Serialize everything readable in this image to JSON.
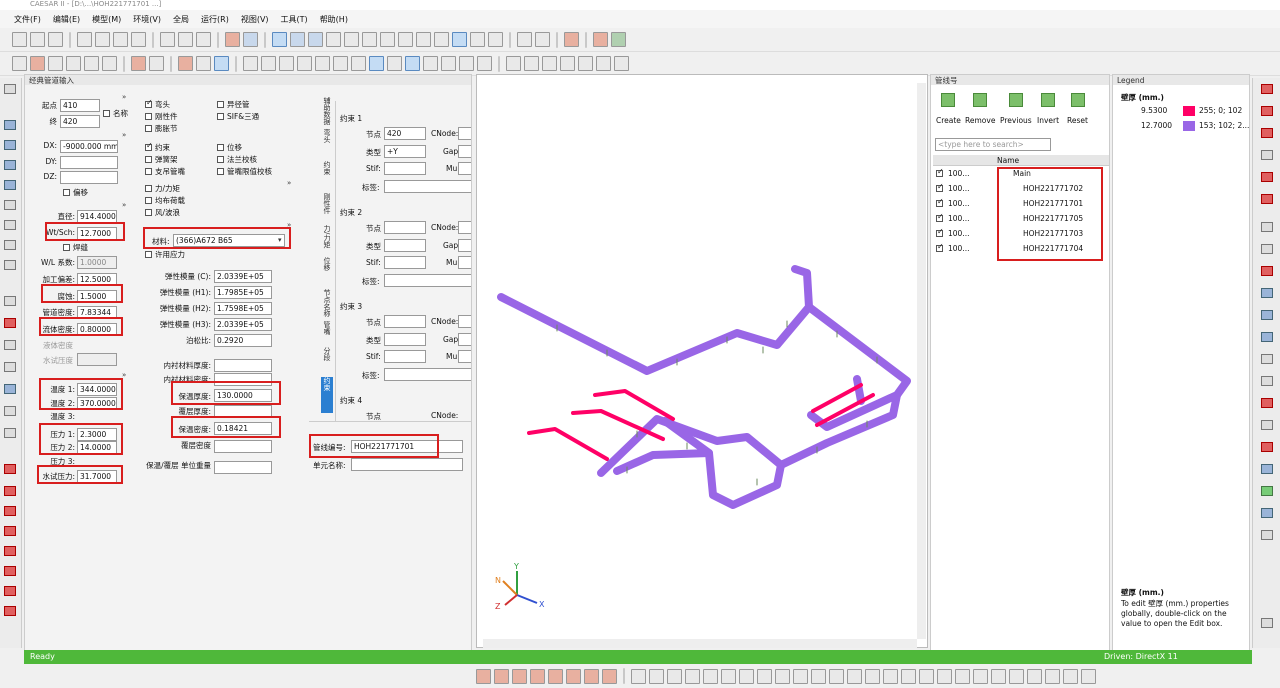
{
  "window": {
    "title": "CAESAR II - [D:\\...\\HOH221771701 ...]"
  },
  "menu": [
    "文件(F)",
    "编辑(E)",
    "模型(M)",
    "环境(V)",
    "全局",
    "运行(R)",
    "视图(V)",
    "工具(T)",
    "帮助(H)"
  ],
  "left_panel": {
    "title": "经典管道输入",
    "from_label": "起点",
    "from_value": "410",
    "to_label": "终",
    "to_value": "420",
    "name_label": "名称",
    "dx_label": "DX:",
    "dx_value": "-9000.000 mm",
    "dy_label": "DY:",
    "dz_label": "DZ:",
    "offset_label": "偏移",
    "diameter_label": "直径:",
    "diameter_value": "914.4000",
    "wt_label": "Wt/Sch:",
    "wt_value": "12.7000",
    "seam_label": "焊缝",
    "wl_factor_label": "W/L 系数:",
    "wl_factor_value": "1.0000",
    "mill_tol_label": "加工偏差:",
    "mill_tol_value": "12.5000",
    "corrosion_label": "腐蚀:",
    "corrosion_value": "1.5000",
    "pipe_density_label": "管道密度:",
    "pipe_density_value": "7.83344",
    "fluid_density_label": "流体密度:",
    "fluid_density_value": "0.80000",
    "liquid_label": "液体密度",
    "hydro_density_label": "水试压度",
    "temp1_label": "温度 1:",
    "temp1_value": "344.0000",
    "temp2_label": "温度 2:",
    "temp2_value": "370.0000",
    "temp3_label": "温度 3:",
    "press1_label": "压力 1:",
    "press1_value": "2.3000",
    "press2_label": "压力 2:",
    "press2_value": "14.0000",
    "press3_label": "压力 3:",
    "hydro_label": "水试压力:",
    "hydro_value": "31.7000",
    "checks_a": [
      {
        "label": "弯头",
        "on": false
      },
      {
        "label": "刚性件",
        "on": false
      },
      {
        "label": "膨胀节",
        "on": false
      },
      {
        "label": "约束",
        "on": true
      },
      {
        "label": "弹簧架",
        "on": false
      },
      {
        "label": "支吊管嘴",
        "on": false
      },
      {
        "label": "力/力矩",
        "on": false
      },
      {
        "label": "均布荷载",
        "on": false
      },
      {
        "label": "风/波浪",
        "on": false
      }
    ],
    "checks_b": [
      {
        "label": "异径管",
        "on": false
      },
      {
        "label": "SIF&三通",
        "on": false
      },
      {
        "label": "位移",
        "on": false
      },
      {
        "label": "法兰校核",
        "on": false
      },
      {
        "label": "管嘴限值校核",
        "on": false
      }
    ],
    "material_label": "材料:",
    "material_value": "(366)A672 B65",
    "allow_label": "许用应力",
    "e_c_label": "弹性模量 (C):",
    "e_c_value": "2.0339E+05",
    "e_h1_label": "弹性模量 (H1):",
    "e_h1_value": "1.7985E+05",
    "e_h2_label": "弹性模量 (H2):",
    "e_h2_value": "1.7598E+05",
    "e_h3_label": "弹性模量 (H3):",
    "e_h3_value": "2.0339E+05",
    "poisson_label": "泊松比:",
    "poisson_value": "0.2920",
    "lining_thk_label": "内衬材料厚度:",
    "lining_den_label": "内衬材料密度:",
    "ins_thk_label": "保温厚度:",
    "ins_thk_value": "130.0000",
    "clad_thk_label": "覆层厚度:",
    "ins_den_label": "保温密度:",
    "ins_den_value": "0.18421",
    "clad_den_label": "覆层密度",
    "unit_wt_label": "保温/覆层 单位重量",
    "vtabs": [
      "辅助数据",
      "弯头",
      "约束",
      "刚性件",
      "力/力矩",
      "位移",
      "节点名称",
      "管嘴",
      "分段",
      "约束"
    ],
    "restraints": [
      {
        "title": "约束 1",
        "node": "420",
        "type": "+Y"
      },
      {
        "title": "约束 2",
        "node": "",
        "type": ""
      },
      {
        "title": "约束 3",
        "node": "",
        "type": ""
      },
      {
        "title": "约束 4",
        "node": "",
        "type": ""
      }
    ],
    "r_node_label": "节点",
    "r_cnode_label": "CNode:",
    "r_type_label": "类型",
    "r_gap_label": "Gap:",
    "r_stif_label": "Stif:",
    "r_mu_label": "Mu:",
    "r_tag_label": "标签:",
    "line_no_label": "管线编号:",
    "line_no_value": "HOH221771701",
    "element_name_label": "单元名称:"
  },
  "pipe_panel": {
    "title": "管线号",
    "buttons": [
      "Create",
      "Remove",
      "Previous",
      "Invert",
      "Reset"
    ],
    "search_placeholder": "<type here to search>",
    "col_name": "Name",
    "rows": [
      {
        "v": "100...",
        "name": "Main"
      },
      {
        "v": "100...",
        "name": "HOH221771702"
      },
      {
        "v": "100...",
        "name": "HOH221771701"
      },
      {
        "v": "100...",
        "name": "HOH221771705"
      },
      {
        "v": "100...",
        "name": "HOH221771703"
      },
      {
        "v": "100...",
        "name": "HOH221771704"
      }
    ]
  },
  "legend": {
    "title": "Legend",
    "group": "壁厚 (mm.)",
    "items": [
      {
        "value": "9.5300",
        "color": "#ff0066",
        "rgb": "255; 0; 102"
      },
      {
        "value": "12.7000",
        "color": "#9966e6",
        "rgb": "153; 102; 2..."
      }
    ],
    "desc_title": "壁厚 (mm.)",
    "desc_text": "To edit 壁厚 (mm.) properties globally, double-click on the value to open the Edit box."
  },
  "status": {
    "left": "Ready",
    "right": "Driven: DirectX 11"
  },
  "colors": {
    "pipe": "#9966e6",
    "pipe_thin": "#ff0066",
    "status": "#4fb83a",
    "highlight": "#d81e1e"
  },
  "axes": {
    "x": "X",
    "y": "Y",
    "z": "Z",
    "n": "N"
  }
}
